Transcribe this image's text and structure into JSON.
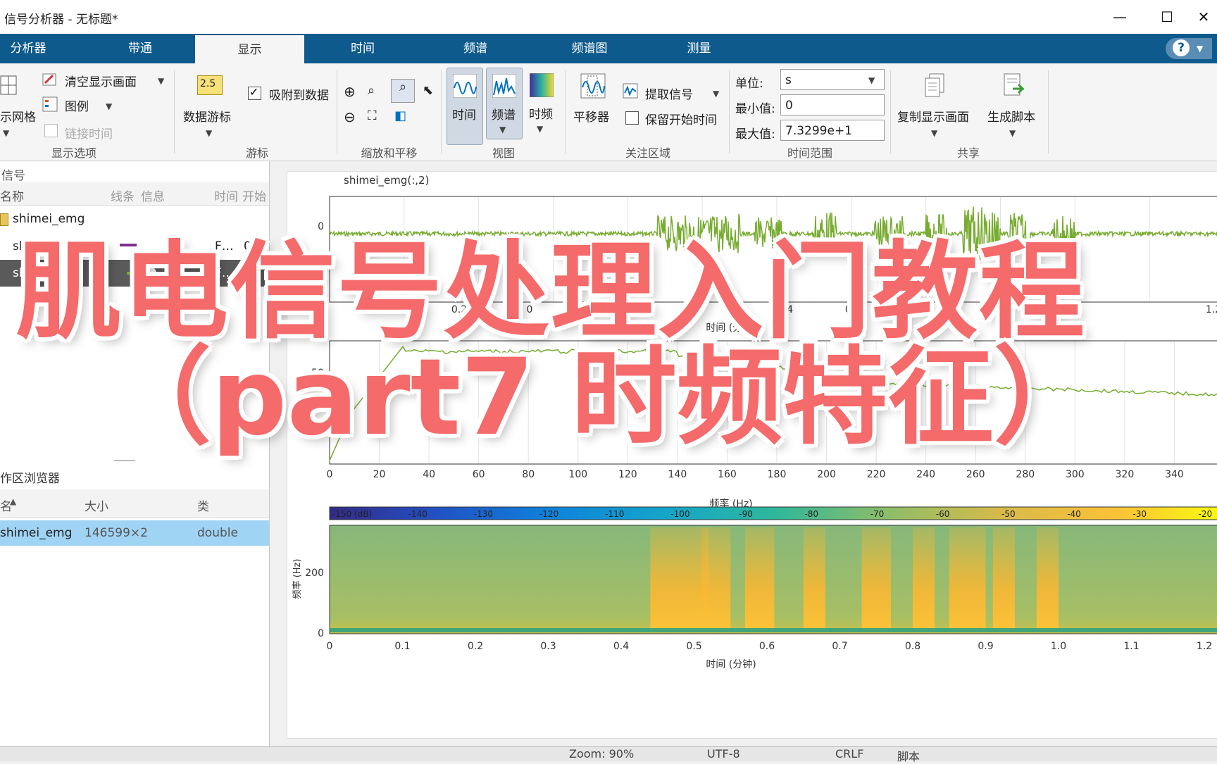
{
  "window": {
    "title": "信号分析器 - 无标题*",
    "minimize": "—",
    "maximize": "☐",
    "close": "✕"
  },
  "tabs": [
    {
      "label": "分析器"
    },
    {
      "label": "带通"
    },
    {
      "label": "显示"
    },
    {
      "label": "时间"
    },
    {
      "label": "频谱"
    },
    {
      "label": "频谱图"
    },
    {
      "label": "测量"
    }
  ],
  "active_tab": "显示",
  "help": "?",
  "ribbon": {
    "display_options": {
      "grid": "示网格",
      "clear": "清空显示画面",
      "legend": "图例",
      "link_time": "链接时间",
      "label": "显示选项"
    },
    "cursor": {
      "data_cursor": "数据游标",
      "snap_to_data": "吸附到数据",
      "icon_text": "2.5",
      "label": "游标"
    },
    "zoom_pan": {
      "label": "缩放和平移"
    },
    "view": {
      "time": "时间",
      "spectrum": "频谱",
      "time_freq": "时频",
      "label": "视图"
    },
    "roi": {
      "panner": "平移器",
      "extract": "提取信号",
      "keep_start": "保留开始时间",
      "label": "关注区域"
    },
    "time_range": {
      "unit_label": "单位:",
      "unit_value": "s",
      "min_label": "最小值:",
      "min_value": "0",
      "max_label": "最大值:",
      "max_value": "7.3299e+1",
      "label": "时间范围"
    },
    "share": {
      "copy_display": "复制显示画面",
      "gen_script": "生成脚本",
      "label": "共享"
    }
  },
  "signals_panel": {
    "title": "信号",
    "columns": [
      "名称",
      "线条",
      "信息",
      "时间",
      "开始"
    ],
    "group": "shimei_emg",
    "rows": [
      {
        "name": "shimei_emg(:,1)",
        "info": "F…",
        "start": "0 s",
        "color": "#7e2f8e"
      },
      {
        "name": "sh",
        "info": "F…",
        "start": "0 s",
        "color": "#77ac30"
      }
    ]
  },
  "workspace_panel": {
    "title": "作区浏览器",
    "columns": [
      "名",
      "大小",
      "类"
    ],
    "rows": [
      {
        "name": "shimei_emg",
        "size": "146599×2",
        "class": "double"
      }
    ]
  },
  "plot1": {
    "legend": "shimei_emg(:,2)",
    "ytick": "0",
    "xticks": [
      "0.2",
      "0",
      "0.4",
      "0.8",
      "1.2"
    ],
    "xlabel": "时间 (分钟)"
  },
  "plot2": {
    "ytick": "-50",
    "xticks": [
      "0",
      "20",
      "40",
      "60",
      "80",
      "100",
      "120",
      "140",
      "160",
      "180",
      "200",
      "220",
      "240",
      "260",
      "280",
      "300",
      "320",
      "340"
    ],
    "xlabel": "频率 (Hz)"
  },
  "plot3": {
    "colorbar_ticks": [
      "-150 (dB)",
      "-140",
      "-130",
      "-120",
      "-110",
      "-100",
      "-90",
      "-80",
      "-70",
      "-60",
      "-50",
      "-40",
      "-30",
      "-20"
    ],
    "yticks": [
      "200",
      "0"
    ],
    "ylabel": "频率 (Hz)",
    "xticks": [
      "0",
      "0.1",
      "0.2",
      "0.3",
      "0.4",
      "0.5",
      "0.6",
      "0.7",
      "0.8",
      "0.9",
      "1.0",
      "1.1",
      "1.2"
    ],
    "xlabel": "时间 (分钟)"
  },
  "status_bar": {
    "zoom": "Zoom: 90%",
    "encoding": "UTF-8",
    "eol": "CRLF",
    "type": "脚本"
  },
  "overlay": {
    "line1": "肌电信号处理入门教程",
    "line2": "（part7 时频特征）"
  },
  "colors": {
    "signal_green": "#77ac30",
    "tab_blue": "#0e5a8c",
    "overlay_red": "#f56a6a"
  }
}
